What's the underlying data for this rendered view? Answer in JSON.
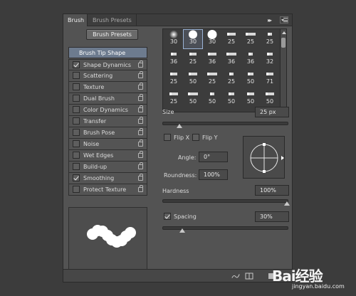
{
  "tabs": [
    {
      "label": "Brush",
      "active": true
    },
    {
      "label": "Brush Presets",
      "active": false
    }
  ],
  "presets_button": "Brush Presets",
  "options_header": "Brush Tip Shape",
  "options": [
    {
      "label": "Shape Dynamics",
      "checked": true
    },
    {
      "label": "Scattering",
      "checked": false
    },
    {
      "label": "Texture",
      "checked": false
    },
    {
      "label": "Dual Brush",
      "checked": false
    },
    {
      "label": "Color Dynamics",
      "checked": false
    },
    {
      "label": "Transfer",
      "checked": false
    },
    {
      "label": "Brush Pose",
      "checked": false
    },
    {
      "label": "Noise",
      "checked": false
    },
    {
      "label": "Wet Edges",
      "checked": false
    },
    {
      "label": "Build-up",
      "checked": false
    },
    {
      "label": "Smoothing",
      "checked": true
    },
    {
      "label": "Protect Texture",
      "checked": false
    }
  ],
  "tips": {
    "rows": [
      [
        "30",
        "30",
        "30",
        "25",
        "25",
        "25"
      ],
      [
        "36",
        "25",
        "36",
        "36",
        "36",
        "32"
      ],
      [
        "25",
        "50",
        "25",
        "25",
        "50",
        "71"
      ],
      [
        "25",
        "50",
        "50",
        "50",
        "50",
        "50"
      ]
    ],
    "selected": "row0-col1"
  },
  "size": {
    "label": "Size",
    "value": "25 px",
    "level": 0.13
  },
  "flip_x": {
    "label": "Flip X",
    "checked": false
  },
  "flip_y": {
    "label": "Flip Y",
    "checked": false
  },
  "angle": {
    "label": "Angle:",
    "value": "0°"
  },
  "roundness": {
    "label": "Roundness:",
    "value": "100%"
  },
  "hardness": {
    "label": "Hardness",
    "value": "100%",
    "level": 1.0
  },
  "spacing": {
    "label": "Spacing",
    "value": "30%",
    "checked": true,
    "level": 0.15
  },
  "watermark": {
    "text": "Bai经验",
    "url": "jingyan.baidu.com"
  },
  "colors": {
    "panel": "#535353",
    "header": "#6d7b8e",
    "background": "#3c3c3c"
  }
}
